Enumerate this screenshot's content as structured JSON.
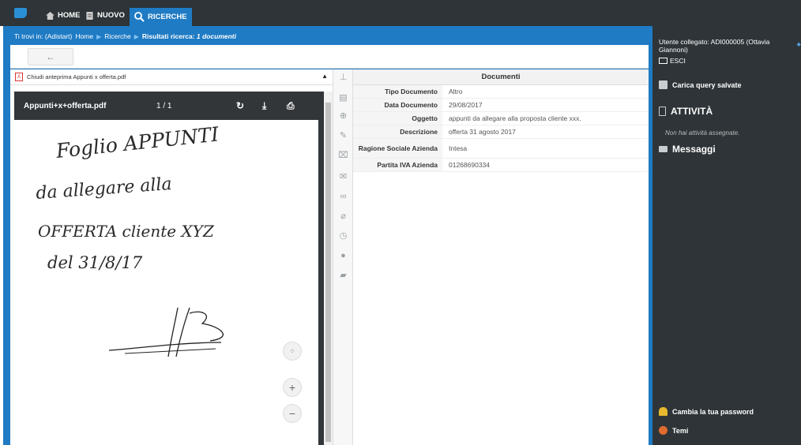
{
  "nav": {
    "home": "HOME",
    "nuovo": "NUOVO",
    "ricerche": "RICERCHE"
  },
  "breadcrumb": {
    "prefix": "Ti trovi in: (Adistart)",
    "home": "Home",
    "ricerche": "Ricerche",
    "risultati": "Risultati ricerca:",
    "count": "1 documenti"
  },
  "toolbar": {
    "back_icon": "←"
  },
  "preview": {
    "close_label": "Chiudi anteprima Appunti x offerta.pdf",
    "viewer_title": "Appunti+x+offerta.pdf",
    "page_indicator": "1 / 1",
    "handwriting": {
      "line1": "Foglio APPUNTI",
      "line2": "da allegare alla",
      "line3": "OFFERTA cliente XYZ",
      "line4": "del 31/8/17"
    }
  },
  "documents": {
    "header": "Documenti",
    "rows": [
      {
        "label": "Tipo Documento",
        "value": "Altro"
      },
      {
        "label": "Data Documento",
        "value": "29/08/2017"
      },
      {
        "label": "Oggetto",
        "value": "appunti da allegare alla proposta cliente xxx."
      },
      {
        "label": "Descrizione",
        "value": "offerta 31 agosto 2017"
      },
      {
        "label": "Ragione Sociale Azienda",
        "value": "Intesa"
      },
      {
        "label": "Partita IVA Azienda",
        "value": "01268690334"
      }
    ]
  },
  "sidebar": {
    "user": "Utente collegato: ADI000005 (Ottavia Giannoni)",
    "esci": "ESCI",
    "carica_query": "Carica query salvate",
    "attivita": "ATTIVITÀ",
    "no_activity": "Non hai attività assegnate.",
    "messaggi": "Messaggi",
    "cambia_password": "Cambia la tua password",
    "temi": "Temi"
  },
  "colors": {
    "brand_blue": "#1f7bc4",
    "dark": "#2e3438"
  }
}
